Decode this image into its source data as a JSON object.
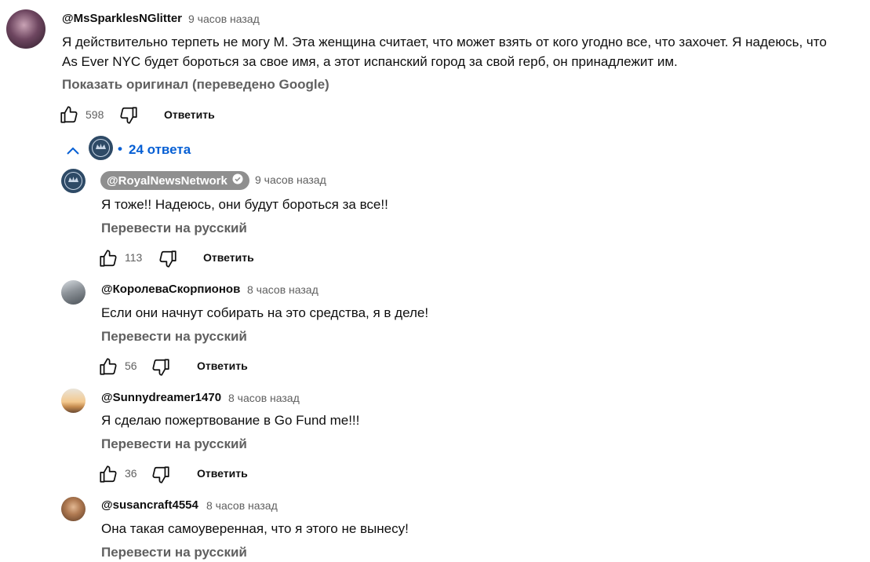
{
  "main_comment": {
    "author": "@MsSparklesNGlitter",
    "time": "9 часов назад",
    "text_line1": "Я действительно терпеть не могу М. Эта женщина считает, что может взять от кого угодно все, что захочет. Я надеюсь, что",
    "text_line2": "As Ever NYC будет бороться за свое имя, а этот испанский город за свой герб, он принадлежит им.",
    "translate_link": "Показать оригинал (переведено Google)",
    "likes": "598",
    "reply_label": "Ответить"
  },
  "replies_toggle": {
    "label": "24 ответа",
    "bullet": "•"
  },
  "replies": [
    {
      "author": "@RoyalNewsNetwork",
      "time": "9 часов назад",
      "text": "Я тоже!! Надеюсь, они будут бороться за все!!",
      "translate_link": "Перевести на русский",
      "likes": "113",
      "reply_label": "Ответить"
    },
    {
      "author": "@КоролеваСкорпионов",
      "time": "8 часов назад",
      "text": "Если они начнут собирать на это средства, я в деле!",
      "translate_link": "Перевести на русский",
      "likes": "56",
      "reply_label": "Ответить"
    },
    {
      "author": "@Sunnydreamer1470",
      "time": "8 часов назад",
      "text": "Я сделаю пожертвование в Go Fund me!!!",
      "translate_link": "Перевести на русский",
      "likes": "36",
      "reply_label": "Ответить"
    },
    {
      "author": "@susancraft4554",
      "time": "8 часов назад",
      "text": "Она такая самоуверенная, что я этого не вынесу!",
      "translate_link": "Перевести на русский"
    }
  ],
  "colors": {
    "link_blue": "#065fd4",
    "secondary_text": "#606060",
    "creator_chip": "#8f8f8f"
  }
}
